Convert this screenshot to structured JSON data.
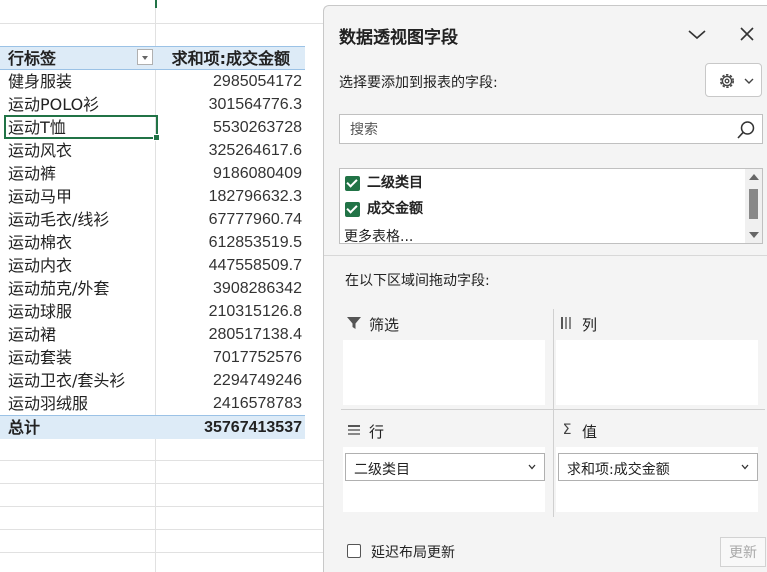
{
  "pivot": {
    "header_row": "行标签",
    "header_value": "求和项:成交金额",
    "rows": [
      {
        "label": "健身服装",
        "value": "2985054172"
      },
      {
        "label": "运动POLO衫",
        "value": "301564776.3"
      },
      {
        "label": "运动T恤",
        "value": "5530263728"
      },
      {
        "label": "运动风衣",
        "value": "325264617.6"
      },
      {
        "label": "运动裤",
        "value": "9186080409"
      },
      {
        "label": "运动马甲",
        "value": "182796632.3"
      },
      {
        "label": "运动毛衣/线衫",
        "value": "67777960.74"
      },
      {
        "label": "运动棉衣",
        "value": "612853519.5"
      },
      {
        "label": "运动内衣",
        "value": "447558509.7"
      },
      {
        "label": "运动茄克/外套",
        "value": "3908286342"
      },
      {
        "label": "运动球服",
        "value": "210315126.8"
      },
      {
        "label": "运动裙",
        "value": "280517138.4"
      },
      {
        "label": "运动套装",
        "value": "7017752576"
      },
      {
        "label": "运动卫衣/套头衫",
        "value": "2294749246"
      },
      {
        "label": "运动羽绒服",
        "value": "2416578783"
      }
    ],
    "total_label": "总计",
    "total_value": "35767413537"
  },
  "pane": {
    "title": "数据透视图字段",
    "choose_label": "选择要添加到报表的字段:",
    "search_placeholder": "搜索",
    "fields": [
      {
        "label": "二级类目",
        "checked": true
      },
      {
        "label": "成交金额",
        "checked": true
      }
    ],
    "more_tables": "更多表格...",
    "drag_label": "在以下区域间拖动字段:",
    "zones": {
      "filter": {
        "title": "筛选",
        "icon": "filter-icon"
      },
      "columns": {
        "title": "列",
        "icon": "columns-icon"
      },
      "rows": {
        "title": "行",
        "icon": "rows-icon",
        "item": "二级类目"
      },
      "values": {
        "title": "值",
        "icon": "sigma-icon",
        "item": "求和项:成交金额"
      }
    },
    "defer_label": "延迟布局更新",
    "update_button": "更新"
  },
  "colors": {
    "accent": "#217346",
    "pivot_header_bg": "#ddebf7"
  }
}
